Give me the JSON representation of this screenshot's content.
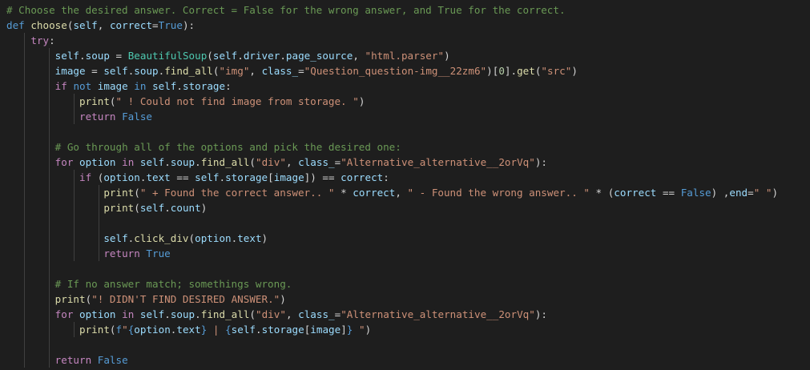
{
  "colors": {
    "background": "#1e1e1e",
    "comment": "#6a9955",
    "keyword": "#569cd6",
    "control": "#c586c0",
    "function": "#dcdcaa",
    "class": "#4ec9b0",
    "string": "#ce9178",
    "variable": "#9cdcfe",
    "number": "#b5cea8",
    "plain": "#d4d4d4"
  },
  "code": {
    "lines": [
      [
        {
          "t": "comment",
          "v": "# Choose the desired answer. Correct = False for the wrong answer, and True for the correct."
        }
      ],
      [
        {
          "t": "keyword",
          "v": "def"
        },
        {
          "t": "plain",
          "v": " "
        },
        {
          "t": "func",
          "v": "choose"
        },
        {
          "t": "plain",
          "v": "("
        },
        {
          "t": "var",
          "v": "self"
        },
        {
          "t": "plain",
          "v": ", "
        },
        {
          "t": "var",
          "v": "correct"
        },
        {
          "t": "plain",
          "v": "="
        },
        {
          "t": "const",
          "v": "True"
        },
        {
          "t": "plain",
          "v": "):"
        }
      ],
      [
        {
          "t": "plain",
          "v": "    "
        },
        {
          "t": "control",
          "v": "try"
        },
        {
          "t": "plain",
          "v": ":"
        }
      ],
      [
        {
          "t": "plain",
          "v": "        "
        },
        {
          "t": "var",
          "v": "self"
        },
        {
          "t": "plain",
          "v": "."
        },
        {
          "t": "var",
          "v": "soup"
        },
        {
          "t": "plain",
          "v": " = "
        },
        {
          "t": "class",
          "v": "BeautifulSoup"
        },
        {
          "t": "plain",
          "v": "("
        },
        {
          "t": "var",
          "v": "self"
        },
        {
          "t": "plain",
          "v": "."
        },
        {
          "t": "var",
          "v": "driver"
        },
        {
          "t": "plain",
          "v": "."
        },
        {
          "t": "var",
          "v": "page_source"
        },
        {
          "t": "plain",
          "v": ", "
        },
        {
          "t": "string",
          "v": "\"html.parser\""
        },
        {
          "t": "plain",
          "v": ")"
        }
      ],
      [
        {
          "t": "plain",
          "v": "        "
        },
        {
          "t": "var",
          "v": "image"
        },
        {
          "t": "plain",
          "v": " = "
        },
        {
          "t": "var",
          "v": "self"
        },
        {
          "t": "plain",
          "v": "."
        },
        {
          "t": "var",
          "v": "soup"
        },
        {
          "t": "plain",
          "v": "."
        },
        {
          "t": "func",
          "v": "find_all"
        },
        {
          "t": "plain",
          "v": "("
        },
        {
          "t": "string",
          "v": "\"img\""
        },
        {
          "t": "plain",
          "v": ", "
        },
        {
          "t": "var",
          "v": "class_"
        },
        {
          "t": "plain",
          "v": "="
        },
        {
          "t": "string",
          "v": "\"Question_question-img__22zm6\""
        },
        {
          "t": "plain",
          "v": ")["
        },
        {
          "t": "num",
          "v": "0"
        },
        {
          "t": "plain",
          "v": "]."
        },
        {
          "t": "func",
          "v": "get"
        },
        {
          "t": "plain",
          "v": "("
        },
        {
          "t": "string",
          "v": "\"src\""
        },
        {
          "t": "plain",
          "v": ")"
        }
      ],
      [
        {
          "t": "plain",
          "v": "        "
        },
        {
          "t": "control",
          "v": "if"
        },
        {
          "t": "plain",
          "v": " "
        },
        {
          "t": "keyword",
          "v": "not"
        },
        {
          "t": "plain",
          "v": " "
        },
        {
          "t": "var",
          "v": "image"
        },
        {
          "t": "plain",
          "v": " "
        },
        {
          "t": "keyword",
          "v": "in"
        },
        {
          "t": "plain",
          "v": " "
        },
        {
          "t": "var",
          "v": "self"
        },
        {
          "t": "plain",
          "v": "."
        },
        {
          "t": "var",
          "v": "storage"
        },
        {
          "t": "plain",
          "v": ":"
        }
      ],
      [
        {
          "t": "plain",
          "v": "            "
        },
        {
          "t": "func",
          "v": "print"
        },
        {
          "t": "plain",
          "v": "("
        },
        {
          "t": "string",
          "v": "\" ! Could not find image from storage. \""
        },
        {
          "t": "plain",
          "v": ")"
        }
      ],
      [
        {
          "t": "plain",
          "v": "            "
        },
        {
          "t": "control",
          "v": "return"
        },
        {
          "t": "plain",
          "v": " "
        },
        {
          "t": "const",
          "v": "False"
        }
      ],
      [],
      [
        {
          "t": "plain",
          "v": "        "
        },
        {
          "t": "comment",
          "v": "# Go through all of the options and pick the desired one:"
        }
      ],
      [
        {
          "t": "plain",
          "v": "        "
        },
        {
          "t": "control",
          "v": "for"
        },
        {
          "t": "plain",
          "v": " "
        },
        {
          "t": "var",
          "v": "option"
        },
        {
          "t": "plain",
          "v": " "
        },
        {
          "t": "control",
          "v": "in"
        },
        {
          "t": "plain",
          "v": " "
        },
        {
          "t": "var",
          "v": "self"
        },
        {
          "t": "plain",
          "v": "."
        },
        {
          "t": "var",
          "v": "soup"
        },
        {
          "t": "plain",
          "v": "."
        },
        {
          "t": "func",
          "v": "find_all"
        },
        {
          "t": "plain",
          "v": "("
        },
        {
          "t": "string",
          "v": "\"div\""
        },
        {
          "t": "plain",
          "v": ", "
        },
        {
          "t": "var",
          "v": "class_"
        },
        {
          "t": "plain",
          "v": "="
        },
        {
          "t": "string",
          "v": "\"Alternative_alternative__2orVq\""
        },
        {
          "t": "plain",
          "v": "):"
        }
      ],
      [
        {
          "t": "plain",
          "v": "            "
        },
        {
          "t": "control",
          "v": "if"
        },
        {
          "t": "plain",
          "v": " ("
        },
        {
          "t": "var",
          "v": "option"
        },
        {
          "t": "plain",
          "v": "."
        },
        {
          "t": "var",
          "v": "text"
        },
        {
          "t": "plain",
          "v": " == "
        },
        {
          "t": "var",
          "v": "self"
        },
        {
          "t": "plain",
          "v": "."
        },
        {
          "t": "var",
          "v": "storage"
        },
        {
          "t": "plain",
          "v": "["
        },
        {
          "t": "var",
          "v": "image"
        },
        {
          "t": "plain",
          "v": "]) == "
        },
        {
          "t": "var",
          "v": "correct"
        },
        {
          "t": "plain",
          "v": ":"
        }
      ],
      [
        {
          "t": "plain",
          "v": "                "
        },
        {
          "t": "func",
          "v": "print"
        },
        {
          "t": "plain",
          "v": "("
        },
        {
          "t": "string",
          "v": "\" + Found the correct answer.. \""
        },
        {
          "t": "plain",
          "v": " * "
        },
        {
          "t": "var",
          "v": "correct"
        },
        {
          "t": "plain",
          "v": ", "
        },
        {
          "t": "string",
          "v": "\" - Found the wrong answer.. \""
        },
        {
          "t": "plain",
          "v": " * ("
        },
        {
          "t": "var",
          "v": "correct"
        },
        {
          "t": "plain",
          "v": " == "
        },
        {
          "t": "const",
          "v": "False"
        },
        {
          "t": "plain",
          "v": ") ,"
        },
        {
          "t": "var",
          "v": "end"
        },
        {
          "t": "plain",
          "v": "="
        },
        {
          "t": "string",
          "v": "\" \""
        },
        {
          "t": "plain",
          "v": ")"
        }
      ],
      [
        {
          "t": "plain",
          "v": "                "
        },
        {
          "t": "func",
          "v": "print"
        },
        {
          "t": "plain",
          "v": "("
        },
        {
          "t": "var",
          "v": "self"
        },
        {
          "t": "plain",
          "v": "."
        },
        {
          "t": "var",
          "v": "count"
        },
        {
          "t": "plain",
          "v": ")"
        }
      ],
      [],
      [
        {
          "t": "plain",
          "v": "                "
        },
        {
          "t": "var",
          "v": "self"
        },
        {
          "t": "plain",
          "v": "."
        },
        {
          "t": "func",
          "v": "click_div"
        },
        {
          "t": "plain",
          "v": "("
        },
        {
          "t": "var",
          "v": "option"
        },
        {
          "t": "plain",
          "v": "."
        },
        {
          "t": "var",
          "v": "text"
        },
        {
          "t": "plain",
          "v": ")"
        }
      ],
      [
        {
          "t": "plain",
          "v": "                "
        },
        {
          "t": "control",
          "v": "return"
        },
        {
          "t": "plain",
          "v": " "
        },
        {
          "t": "const",
          "v": "True"
        }
      ],
      [],
      [
        {
          "t": "plain",
          "v": "        "
        },
        {
          "t": "comment",
          "v": "# If no answer match; somethings wrong."
        }
      ],
      [
        {
          "t": "plain",
          "v": "        "
        },
        {
          "t": "func",
          "v": "print"
        },
        {
          "t": "plain",
          "v": "("
        },
        {
          "t": "string",
          "v": "\"! DIDN'T FIND DESIRED ANSWER.\""
        },
        {
          "t": "plain",
          "v": ")"
        }
      ],
      [
        {
          "t": "plain",
          "v": "        "
        },
        {
          "t": "control",
          "v": "for"
        },
        {
          "t": "plain",
          "v": " "
        },
        {
          "t": "var",
          "v": "option"
        },
        {
          "t": "plain",
          "v": " "
        },
        {
          "t": "control",
          "v": "in"
        },
        {
          "t": "plain",
          "v": " "
        },
        {
          "t": "var",
          "v": "self"
        },
        {
          "t": "plain",
          "v": "."
        },
        {
          "t": "var",
          "v": "soup"
        },
        {
          "t": "plain",
          "v": "."
        },
        {
          "t": "func",
          "v": "find_all"
        },
        {
          "t": "plain",
          "v": "("
        },
        {
          "t": "string",
          "v": "\"div\""
        },
        {
          "t": "plain",
          "v": ", "
        },
        {
          "t": "var",
          "v": "class_"
        },
        {
          "t": "plain",
          "v": "="
        },
        {
          "t": "string",
          "v": "\"Alternative_alternative__2orVq\""
        },
        {
          "t": "plain",
          "v": "):"
        }
      ],
      [
        {
          "t": "plain",
          "v": "            "
        },
        {
          "t": "func",
          "v": "print"
        },
        {
          "t": "plain",
          "v": "("
        },
        {
          "t": "keyword",
          "v": "f"
        },
        {
          "t": "string",
          "v": "\""
        },
        {
          "t": "keyword",
          "v": "{"
        },
        {
          "t": "var",
          "v": "option"
        },
        {
          "t": "plain",
          "v": "."
        },
        {
          "t": "var",
          "v": "text"
        },
        {
          "t": "keyword",
          "v": "}"
        },
        {
          "t": "string",
          "v": " | "
        },
        {
          "t": "keyword",
          "v": "{"
        },
        {
          "t": "var",
          "v": "self"
        },
        {
          "t": "plain",
          "v": "."
        },
        {
          "t": "var",
          "v": "storage"
        },
        {
          "t": "plain",
          "v": "["
        },
        {
          "t": "var",
          "v": "image"
        },
        {
          "t": "plain",
          "v": "]"
        },
        {
          "t": "keyword",
          "v": "}"
        },
        {
          "t": "string",
          "v": " \""
        },
        {
          "t": "plain",
          "v": ")"
        }
      ],
      [],
      [
        {
          "t": "plain",
          "v": "        "
        },
        {
          "t": "control",
          "v": "return"
        },
        {
          "t": "plain",
          "v": " "
        },
        {
          "t": "const",
          "v": "False"
        }
      ]
    ]
  }
}
